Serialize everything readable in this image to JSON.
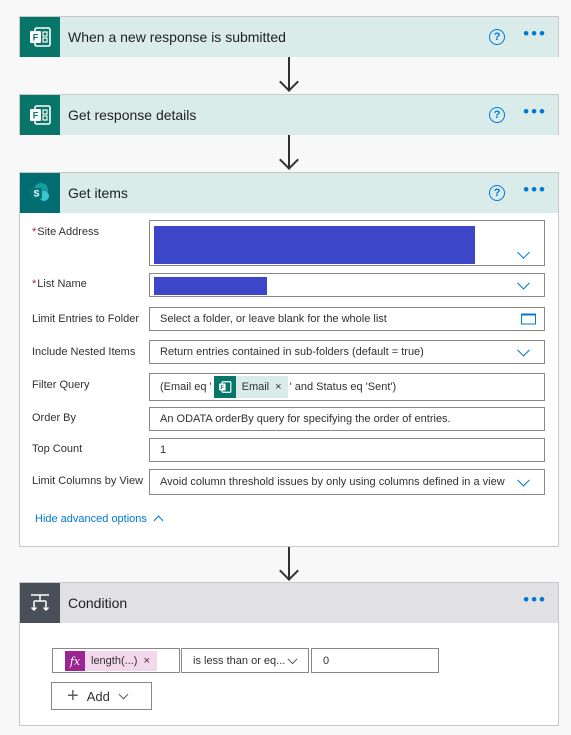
{
  "steps": {
    "trigger": {
      "title": "When a new response is submitted",
      "help": "?",
      "more": "•••"
    },
    "get_response": {
      "title": "Get response details",
      "help": "?",
      "more": "•••"
    },
    "get_items": {
      "title": "Get items",
      "help": "?",
      "more": "•••",
      "fields": {
        "site_address": {
          "label": "Site Address",
          "required_mark": "*",
          "value": ""
        },
        "list_name": {
          "label": "List Name",
          "required_mark": "*",
          "value": ""
        },
        "limit_folder": {
          "label": "Limit Entries to Folder",
          "placeholder": "Select a folder, or leave blank for the whole list"
        },
        "nested": {
          "label": "Include Nested Items",
          "placeholder": "Return entries contained in sub-folders (default = true)"
        },
        "filter": {
          "label": "Filter Query",
          "prefix": "(Email eq '",
          "token": "Email",
          "token_close": "×",
          "suffix": "' and Status eq 'Sent')"
        },
        "order_by": {
          "label": "Order By",
          "placeholder": "An ODATA orderBy query for specifying the order of entries."
        },
        "top_count": {
          "label": "Top Count",
          "value": "1"
        },
        "limit_columns": {
          "label": "Limit Columns by View",
          "placeholder": "Avoid column threshold issues by only using columns defined in a view"
        }
      },
      "advanced_link": "Hide advanced options"
    },
    "condition": {
      "title": "Condition",
      "more": "•••",
      "left_operand": {
        "fx": "fx",
        "label": "length(...)",
        "close": "×"
      },
      "operator": "is less than or eq...",
      "right_operand": "0",
      "add_button": {
        "plus": "+",
        "label": "Add"
      }
    }
  },
  "colors": {
    "accent": "#0078d4",
    "forms_teal": "#077568",
    "sharepoint_teal": "#036c70",
    "redaction": "#3d46c8",
    "expression_purple": "#9b2592"
  }
}
